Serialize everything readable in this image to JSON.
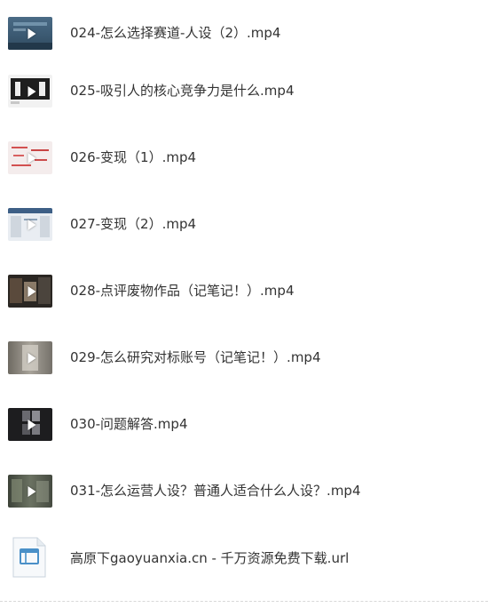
{
  "files": [
    {
      "name": "024-怎么选择赛道-人设（2）.mp4",
      "type": "video",
      "icon": "video-thumbnail-icon"
    },
    {
      "name": "025-吸引人的核心竞争力是什么.mp4",
      "type": "video",
      "icon": "video-thumbnail-icon"
    },
    {
      "name": "026-变现（1）.mp4",
      "type": "video",
      "icon": "video-thumbnail-icon"
    },
    {
      "name": "027-变现（2）.mp4",
      "type": "video",
      "icon": "video-thumbnail-icon"
    },
    {
      "name": "028-点评废物作品（记笔记！）.mp4",
      "type": "video",
      "icon": "video-thumbnail-icon"
    },
    {
      "name": "029-怎么研究对标账号（记笔记！）.mp4",
      "type": "video",
      "icon": "video-thumbnail-icon"
    },
    {
      "name": "030-问题解答.mp4",
      "type": "video",
      "icon": "video-thumbnail-icon"
    },
    {
      "name": "031-怎么运营人设？普通人适合什么人设？.mp4",
      "type": "video",
      "icon": "video-thumbnail-icon"
    },
    {
      "name": "高原下gaoyuanxia.cn - 千万资源免费下载.url",
      "type": "url",
      "icon": "url-file-icon"
    }
  ],
  "colors": {
    "text": "#333333",
    "url_icon_accent": "#4a90c8"
  }
}
